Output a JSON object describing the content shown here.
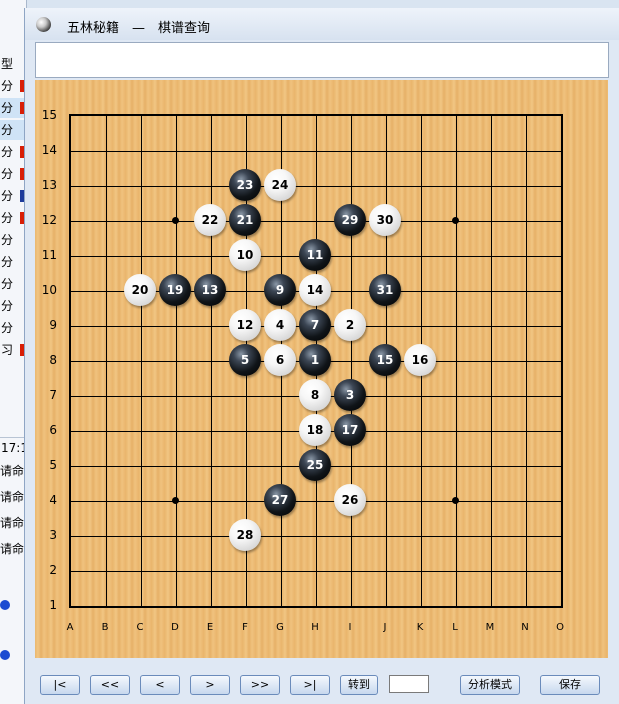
{
  "dialog": {
    "title": "五林秘籍　—　棋谱查询",
    "comment": ""
  },
  "board": {
    "row_labels": [
      "15",
      "14",
      "13",
      "12",
      "11",
      "10",
      "9",
      "8",
      "7",
      "6",
      "5",
      "4",
      "3",
      "2",
      "1"
    ],
    "col_labels": [
      "A",
      "B",
      "C",
      "D",
      "E",
      "F",
      "G",
      "H",
      "I",
      "J",
      "K",
      "L",
      "M",
      "N",
      "O"
    ],
    "stones": [
      {
        "n": 1,
        "color": "black",
        "col": "H",
        "row": 8
      },
      {
        "n": 2,
        "color": "white",
        "col": "I",
        "row": 9
      },
      {
        "n": 3,
        "color": "black",
        "col": "I",
        "row": 7
      },
      {
        "n": 4,
        "color": "white",
        "col": "G",
        "row": 9
      },
      {
        "n": 5,
        "color": "black",
        "col": "F",
        "row": 8
      },
      {
        "n": 6,
        "color": "white",
        "col": "G",
        "row": 8
      },
      {
        "n": 7,
        "color": "black",
        "col": "H",
        "row": 9
      },
      {
        "n": 8,
        "color": "white",
        "col": "H",
        "row": 7
      },
      {
        "n": 9,
        "color": "black",
        "col": "G",
        "row": 10
      },
      {
        "n": 10,
        "color": "white",
        "col": "F",
        "row": 11
      },
      {
        "n": 11,
        "color": "black",
        "col": "H",
        "row": 11
      },
      {
        "n": 12,
        "color": "white",
        "col": "F",
        "row": 9
      },
      {
        "n": 13,
        "color": "black",
        "col": "E",
        "row": 10
      },
      {
        "n": 14,
        "color": "white",
        "col": "H",
        "row": 10
      },
      {
        "n": 15,
        "color": "black",
        "col": "J",
        "row": 8
      },
      {
        "n": 16,
        "color": "white",
        "col": "K",
        "row": 8
      },
      {
        "n": 17,
        "color": "black",
        "col": "I",
        "row": 6
      },
      {
        "n": 18,
        "color": "white",
        "col": "H",
        "row": 6
      },
      {
        "n": 19,
        "color": "black",
        "col": "D",
        "row": 10
      },
      {
        "n": 20,
        "color": "white",
        "col": "C",
        "row": 10
      },
      {
        "n": 21,
        "color": "black",
        "col": "F",
        "row": 12
      },
      {
        "n": 22,
        "color": "white",
        "col": "E",
        "row": 12
      },
      {
        "n": 23,
        "color": "black",
        "col": "F",
        "row": 13
      },
      {
        "n": 24,
        "color": "white",
        "col": "G",
        "row": 13
      },
      {
        "n": 25,
        "color": "black",
        "col": "H",
        "row": 5
      },
      {
        "n": 26,
        "color": "white",
        "col": "I",
        "row": 4
      },
      {
        "n": 27,
        "color": "black",
        "col": "G",
        "row": 4
      },
      {
        "n": 28,
        "color": "white",
        "col": "F",
        "row": 3
      },
      {
        "n": 29,
        "color": "black",
        "col": "I",
        "row": 12
      },
      {
        "n": 30,
        "color": "white",
        "col": "J",
        "row": 12
      },
      {
        "n": 31,
        "color": "black",
        "col": "J",
        "row": 10
      }
    ],
    "star_points": [
      {
        "col": "D",
        "row": 12
      },
      {
        "col": "L",
        "row": 12
      },
      {
        "col": "D",
        "row": 4
      },
      {
        "col": "L",
        "row": 4
      }
    ]
  },
  "toolbar": {
    "first": "|<",
    "prev_many": "<<",
    "prev": "<",
    "next": ">",
    "next_many": ">>",
    "last": ">|",
    "goto": "转到",
    "goto_value": "",
    "analysis": "分析模式",
    "save": "保存"
  },
  "background": {
    "list_header": "型",
    "rows": [
      {
        "text": "分",
        "flag": "red"
      },
      {
        "text": "分",
        "flag": "red"
      },
      {
        "text": "分",
        "flag": ""
      },
      {
        "text": "分",
        "flag": "red"
      },
      {
        "text": "分",
        "flag": "red"
      },
      {
        "text": "分",
        "flag": "blue"
      },
      {
        "text": "分",
        "flag": "red"
      },
      {
        "text": "分",
        "flag": ""
      },
      {
        "text": "分",
        "flag": ""
      },
      {
        "text": "分",
        "flag": ""
      },
      {
        "text": "分",
        "flag": ""
      },
      {
        "text": "分",
        "flag": ""
      },
      {
        "text": "习",
        "flag": "red"
      }
    ],
    "time": "17:1",
    "messages": [
      "请命",
      "请命",
      "请命",
      "请命"
    ]
  }
}
